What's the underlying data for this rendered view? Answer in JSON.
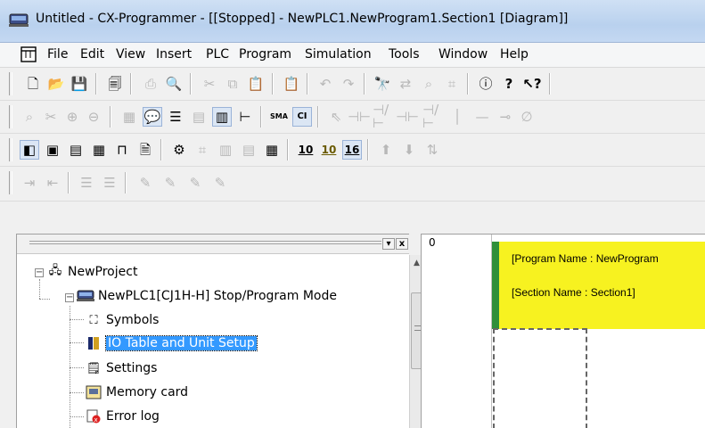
{
  "window": {
    "title": "Untitled - CX-Programmer - [[Stopped] - NewPLC1.NewProgram1.Section1 [Diagram]]",
    "app_icon": "plc-app-icon"
  },
  "menubar": {
    "doc_icon": "document-window-icon",
    "items": [
      "File",
      "Edit",
      "View",
      "Insert",
      "PLC",
      "Program",
      "Simulation",
      "Tools",
      "Window",
      "Help"
    ]
  },
  "toolbars": {
    "row1": [
      "new-icon",
      "open-icon",
      "save-icon",
      "print-preview-icon",
      "print-icon",
      "preview-icon",
      "cut-icon",
      "copy-icon",
      "paste-icon",
      "paste-special-icon",
      "undo-icon",
      "redo-icon",
      "find-icon",
      "replace-icon",
      "find-replace-icon",
      "address-reference-icon",
      "info-icon",
      "help-icon",
      "context-help-icon"
    ],
    "row2": [
      "zoom-to-fit-icon",
      "cut-tool-icon",
      "zoom-in-icon",
      "zoom-out-icon",
      "grid-icon",
      "comment-icon",
      "rung-list-icon",
      "monitor-icon",
      "watch-icon",
      "show-tree-icon",
      "sma-icon",
      "ci-icon",
      "select-mode-icon",
      "contact-no-icon",
      "contact-nc-icon",
      "contact-or-icon",
      "contact-or-nc-icon",
      "vertical-line-icon",
      "horizontal-line-icon",
      "coil-icon",
      "coil-nc-icon"
    ],
    "row3": [
      "project-workspace-icon",
      "output-window-icon",
      "watch-window-icon",
      "address-window-icon",
      "cross-ref-icon",
      "properties-icon",
      "io-comment-icon",
      "symbols-window-icon",
      "memory-icon",
      "display-icon",
      "io-table-icon"
    ],
    "row3_numbers": [
      "10",
      "10",
      "16"
    ],
    "row4": [
      "indent-increase-icon",
      "indent-decrease-icon",
      "align-left-icon",
      "align-right-icon",
      "edit-rung-icon",
      "online-edit-icon",
      "send-edit-icon",
      "cancel-edit-icon"
    ]
  },
  "project_pane": {
    "tree": [
      {
        "label": "NewProject",
        "icon": "project-tree-icon",
        "expander": "−"
      },
      {
        "label": "NewPLC1[CJ1H-H] Stop/Program Mode",
        "icon": "plc-icon",
        "expander": "−"
      },
      {
        "label": "Symbols",
        "icon": "symbols-icon"
      },
      {
        "label": "IO Table and Unit Setup",
        "icon": "io-table-setup-icon",
        "selected": true
      },
      {
        "label": "Settings",
        "icon": "settings-icon"
      },
      {
        "label": "Memory card",
        "icon": "memory-card-icon"
      },
      {
        "label": "Error log",
        "icon": "error-log-icon"
      }
    ],
    "header_buttons": [
      "▾",
      "x"
    ]
  },
  "diagram": {
    "rung_number": "0",
    "program_name": "[Program Name : NewProgram",
    "section_name": "[Section Name : Section1]",
    "colors": {
      "busbar": "#2f8f3a",
      "block": "#f7f220"
    }
  }
}
